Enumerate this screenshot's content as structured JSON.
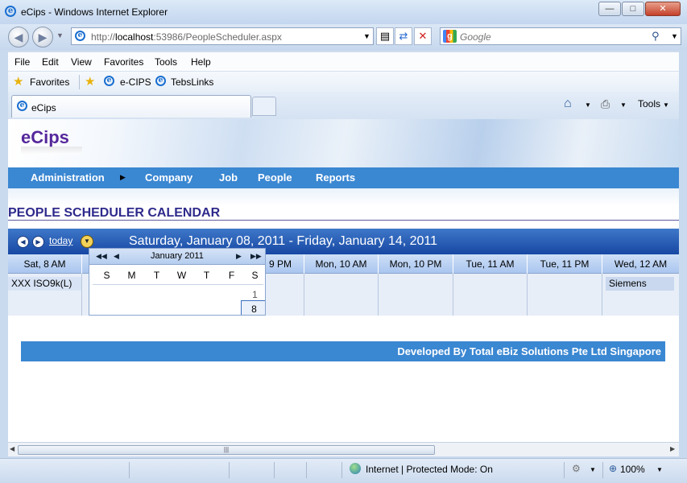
{
  "window": {
    "title": "eCips - Windows Internet Explorer"
  },
  "address": {
    "url_prefix": "http://",
    "url_host": "localhost",
    "url_rest": ":53986/PeopleScheduler.aspx"
  },
  "search": {
    "placeholder": "Google"
  },
  "menu": {
    "file": "File",
    "edit": "Edit",
    "view": "View",
    "favorites": "Favorites",
    "tools": "Tools",
    "help": "Help"
  },
  "favbar": {
    "favorites": "Favorites",
    "link1": "e-CIPS",
    "link2": "TebsLinks"
  },
  "tab": {
    "title": "eCips",
    "tools": "Tools"
  },
  "site": {
    "logo": "eCips",
    "nav": [
      "Administration",
      "Company",
      "Job",
      "People",
      "Reports"
    ],
    "page_title": "PEOPLE SCHEDULER CALENDAR",
    "footer": "Developed By Total eBiz Solutions Pte Ltd Singapore"
  },
  "scheduler": {
    "today_label": "today",
    "range": "Saturday, January 08, 2011 - Friday, January 14, 2011",
    "columns": [
      "Sat, 8 AM",
      "9 PM",
      "Mon, 10 AM",
      "Mon, 10 PM",
      "Tue, 11 AM",
      "Tue, 11 PM",
      "Wed, 12 AM"
    ],
    "events": {
      "first": "XXX ISO9k(L)",
      "last": "Siemens"
    }
  },
  "datepicker": {
    "month": "January 2011",
    "weekdays": [
      "S",
      "M",
      "T",
      "W",
      "T",
      "F",
      "S"
    ],
    "day1": "1",
    "day8": "8"
  },
  "statusbar": {
    "zone": "Internet | Protected Mode: On",
    "zoom": "100%"
  }
}
